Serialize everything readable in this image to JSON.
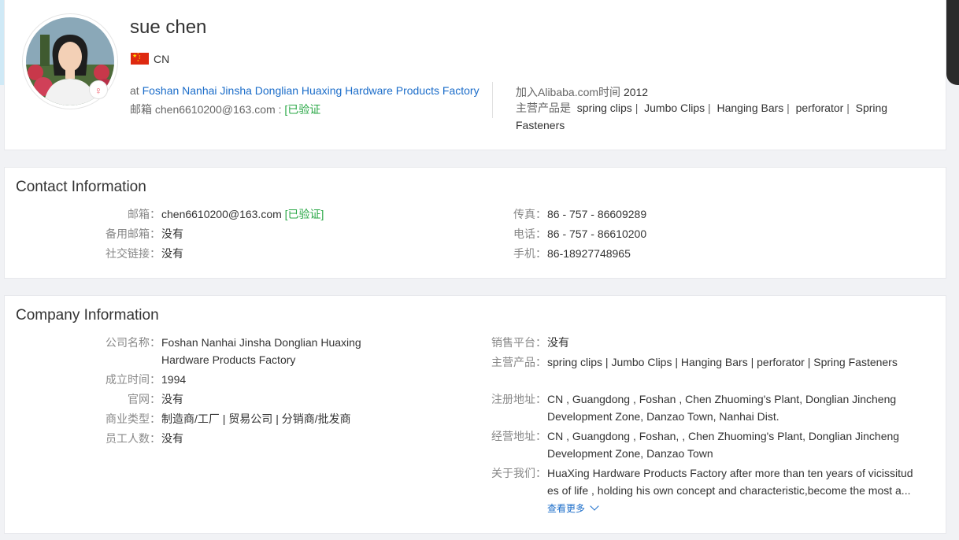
{
  "profile": {
    "name": "sue chen",
    "country": "CN",
    "company_prefix": "at",
    "company_name": "Foshan Nanhai Jinsha Donglian Huaxing Hardware Products Factory",
    "email_label": "邮箱",
    "email": "chen6610200@163.com",
    "verified": "[已验证",
    "joined_label": "加入Alibaba.com时间",
    "joined_year": "2012",
    "products_label": "主营产品是",
    "products": [
      "spring clips",
      "Jumbo Clips",
      "Hanging Bars",
      "perforator",
      "Spring Fasteners"
    ]
  },
  "contact": {
    "title": "Contact Information",
    "left": [
      {
        "label": "邮箱：",
        "value": "chen6610200@163.com",
        "extra": "[已验证]"
      },
      {
        "label": "备用邮箱：",
        "value": "没有"
      },
      {
        "label": "社交链接：",
        "value": "没有"
      }
    ],
    "right": [
      {
        "label": "传真：",
        "value": "86 - 757 - 86609289"
      },
      {
        "label": "电话：",
        "value": "86 - 757 - 86610200"
      },
      {
        "label": "手机：",
        "value": "86-18927748965"
      }
    ]
  },
  "company": {
    "title": "Company Information",
    "left": [
      {
        "label": "公司名称：",
        "value": "Foshan Nanhai Jinsha Donglian Huaxing Hardware Products Factory"
      },
      {
        "label": "成立时间：",
        "value": "1994"
      },
      {
        "label": "官网：",
        "value": "没有"
      },
      {
        "label": "商业类型：",
        "value": "制造商/工厂 | 贸易公司 | 分销商/批发商"
      },
      {
        "label": "员工人数：",
        "value": "没有"
      }
    ],
    "right": [
      {
        "label": "销售平台：",
        "value": "没有"
      },
      {
        "label": "主营产品：",
        "value": "spring clips | Jumbo Clips | Hanging Bars | perforator | Spring Fasteners"
      },
      {
        "label": "注册地址：",
        "value": "CN , Guangdong , Foshan , Chen Zhuoming's Plant, Donglian Jincheng Development Zone, Danzao Town, Nanhai Dist."
      },
      {
        "label": "经营地址：",
        "value": "CN , Guangdong , Foshan, , Chen Zhuoming's Plant, Donglian Jincheng Development Zone, Danzao Town"
      },
      {
        "label": "关于我们：",
        "value": "HuaXing Hardware Products Factory after more than ten years of vicissitud es of life , holding his own concept and characteristic,become the most a..."
      }
    ],
    "more_label": "查看更多"
  },
  "colors": {
    "link": "#1a6cc9",
    "verified": "#28a745",
    "background": "#f1f2f5",
    "flag": "#de2910"
  },
  "icons": [
    "female-icon",
    "china-flag-icon",
    "chevron-down-icon"
  ]
}
